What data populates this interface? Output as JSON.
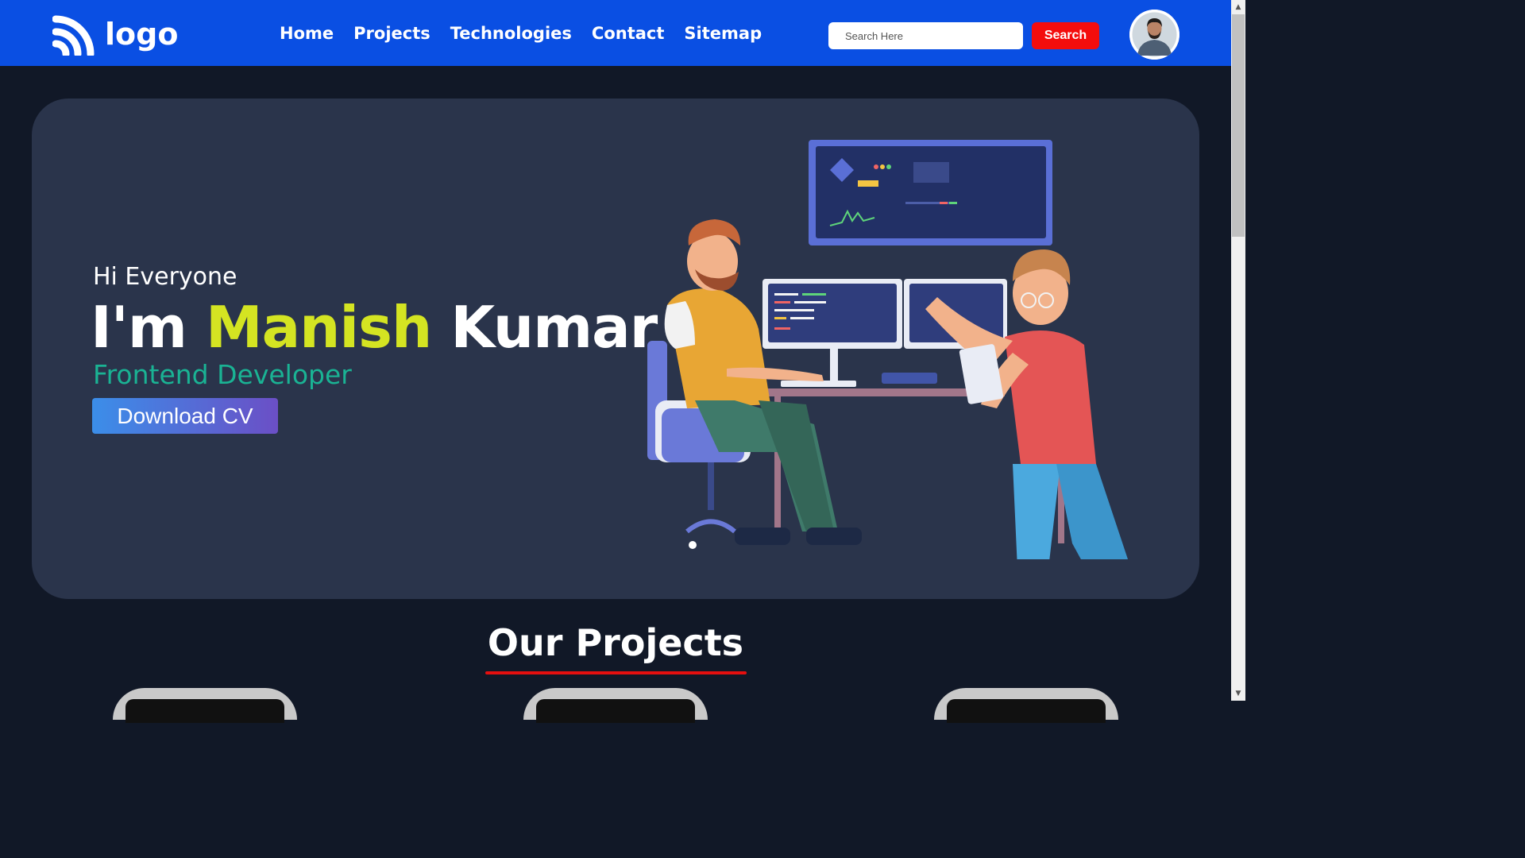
{
  "navbar": {
    "logo_text": "logo",
    "links": [
      "Home",
      "Projects",
      "Technologies",
      "Contact",
      "Sitemap"
    ],
    "search_placeholder": "Search Here",
    "search_button": "Search"
  },
  "hero": {
    "greeting": "Hi Everyone",
    "name_prefix": "I'm",
    "first_name": "Manish",
    "last_name": "Kumar",
    "role": "Frontend Developer",
    "cta_label": "Download CV"
  },
  "projects": {
    "title": "Our Projects"
  },
  "colors": {
    "nav_bg": "#0a4fe3",
    "page_bg": "#111827",
    "hero_bg": "#2a344b",
    "name_highlight": "#d4e422",
    "role": "#1ab394",
    "search_button": "#f40d0d",
    "underline": "#e50f0f"
  },
  "icons": [
    "rss-feed-icon",
    "user-avatar"
  ]
}
